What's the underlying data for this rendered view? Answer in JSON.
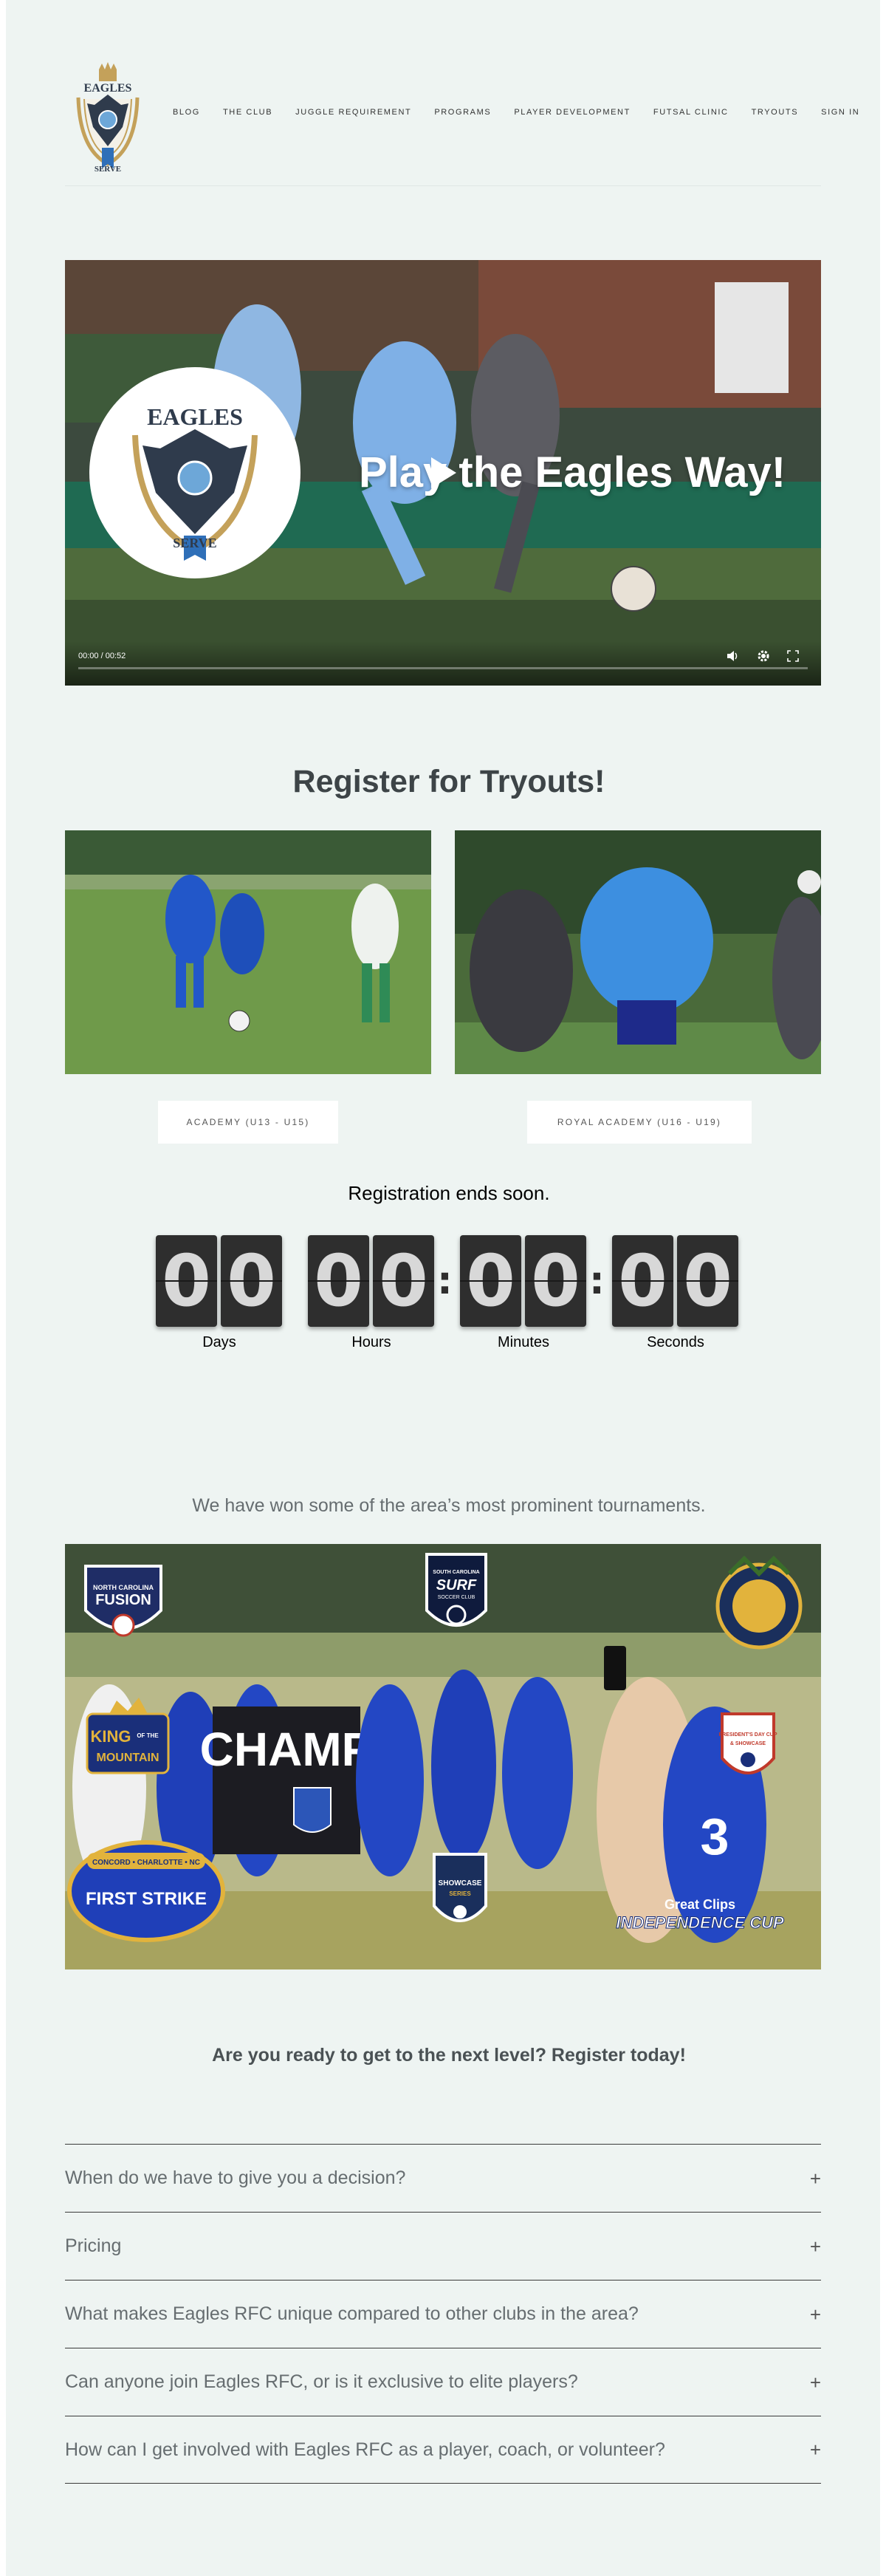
{
  "header": {
    "logo_text_top": "EAGLES",
    "logo_text_bottom": "SERVE",
    "nav": [
      "BLOG",
      "THE CLUB",
      "JUGGLE REQUIREMENT",
      "PROGRAMS",
      "PLAYER DEVELOPMENT",
      "FUTSAL CLINIC",
      "TRYOUTS",
      "SIGN IN"
    ]
  },
  "hero": {
    "title": "Play the Eagles Way!",
    "badge_top": "EAGLES",
    "badge_bottom": "SERVE",
    "time": "00:00 / 00:52",
    "progress": 0
  },
  "tryouts": {
    "title": "Register for Tryouts!",
    "academy_button": "ACADEMY (U13 - U15)",
    "royal_button": "ROYAL ACADEMY (U16 - U19)",
    "ends": "Registration ends soon.",
    "countdown": [
      {
        "value": "00",
        "label": "Days"
      },
      {
        "value": "00",
        "label": "Hours"
      },
      {
        "value": "00",
        "label": "Minutes"
      },
      {
        "value": "00",
        "label": "Seconds"
      }
    ]
  },
  "tournaments": {
    "text": "We have won some of the area’s most prominent tournaments.",
    "badges": {
      "fusion_1": "NORTH CAROLINA",
      "fusion_2": "FUSION",
      "surf_1": "SOUTH CAROLINA",
      "surf_2": "SURF",
      "surf_3": "SOCCER CLUB",
      "king_1": "KING",
      "king_2": "OF THE",
      "king_3": "MOUNTAIN",
      "presidents_1": "PRESIDENT'S DAY CUP",
      "presidents_2": "& SHOWCASE",
      "strike_1": "CONCORD • CHARLOTTE • NC",
      "strike_2": "FIRST STRIKE",
      "showcase_1": "SHOWCASE",
      "showcase_2": "SERIES",
      "indep_1": "Great Clips",
      "indep_2": "INDEPENDENCE CUP",
      "banner": "CHAMP"
    }
  },
  "cta": "Are you ready to get to the next level? Register today!",
  "faq": [
    "When do we have to give you a decision?",
    "Pricing",
    "What makes Eagles RFC unique compared to other clubs in the area?",
    "Can anyone join Eagles RFC, or is it exclusive to elite players?",
    "How can I get involved with Eagles RFC as a player, coach, or volunteer?"
  ],
  "colors": {
    "page_bg": "#eef4f2",
    "navy": "#2f3b4c",
    "gold": "#c4a15a",
    "kit_blue": "#2a5bd7"
  }
}
